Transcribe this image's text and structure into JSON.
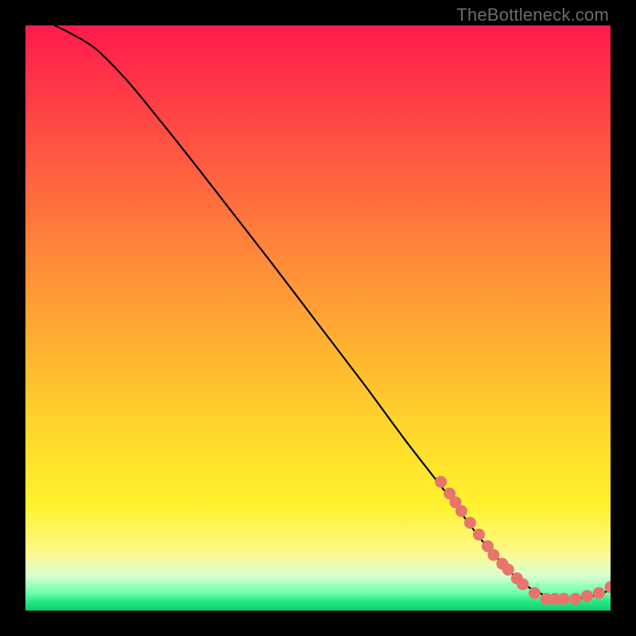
{
  "watermark": "TheBottleneck.com",
  "chart_data": {
    "type": "line",
    "title": "",
    "xlabel": "",
    "ylabel": "",
    "xlim": [
      0,
      100
    ],
    "ylim": [
      0,
      100
    ],
    "grid": false,
    "series": [
      {
        "name": "bottleneck-curve",
        "x": [
          5,
          8,
          12,
          17,
          22,
          28,
          35,
          42,
          50,
          58,
          65,
          72,
          78,
          83,
          86,
          89,
          91,
          94,
          97,
          100
        ],
        "y": [
          100,
          98.5,
          96,
          91,
          85,
          77.5,
          68.5,
          59.5,
          49,
          38.5,
          29,
          20,
          12,
          6.5,
          4,
          2.5,
          2,
          2,
          2.5,
          3.5
        ]
      }
    ],
    "markers": [
      {
        "name": "highlighted-points",
        "color": "#e8746c",
        "points": [
          {
            "x": 71,
            "y": 22
          },
          {
            "x": 72.5,
            "y": 20
          },
          {
            "x": 73.5,
            "y": 18.5
          },
          {
            "x": 74.5,
            "y": 17
          },
          {
            "x": 76,
            "y": 15
          },
          {
            "x": 77.5,
            "y": 13
          },
          {
            "x": 79,
            "y": 11
          },
          {
            "x": 80,
            "y": 9.5
          },
          {
            "x": 81.5,
            "y": 8
          },
          {
            "x": 82.5,
            "y": 7
          },
          {
            "x": 84,
            "y": 5.5
          },
          {
            "x": 85,
            "y": 4.5
          },
          {
            "x": 87,
            "y": 3
          },
          {
            "x": 89,
            "y": 2
          },
          {
            "x": 90.5,
            "y": 2
          },
          {
            "x": 92,
            "y": 2
          },
          {
            "x": 94,
            "y": 2
          },
          {
            "x": 96,
            "y": 2.5
          },
          {
            "x": 98,
            "y": 3
          },
          {
            "x": 100,
            "y": 4
          }
        ]
      }
    ]
  }
}
